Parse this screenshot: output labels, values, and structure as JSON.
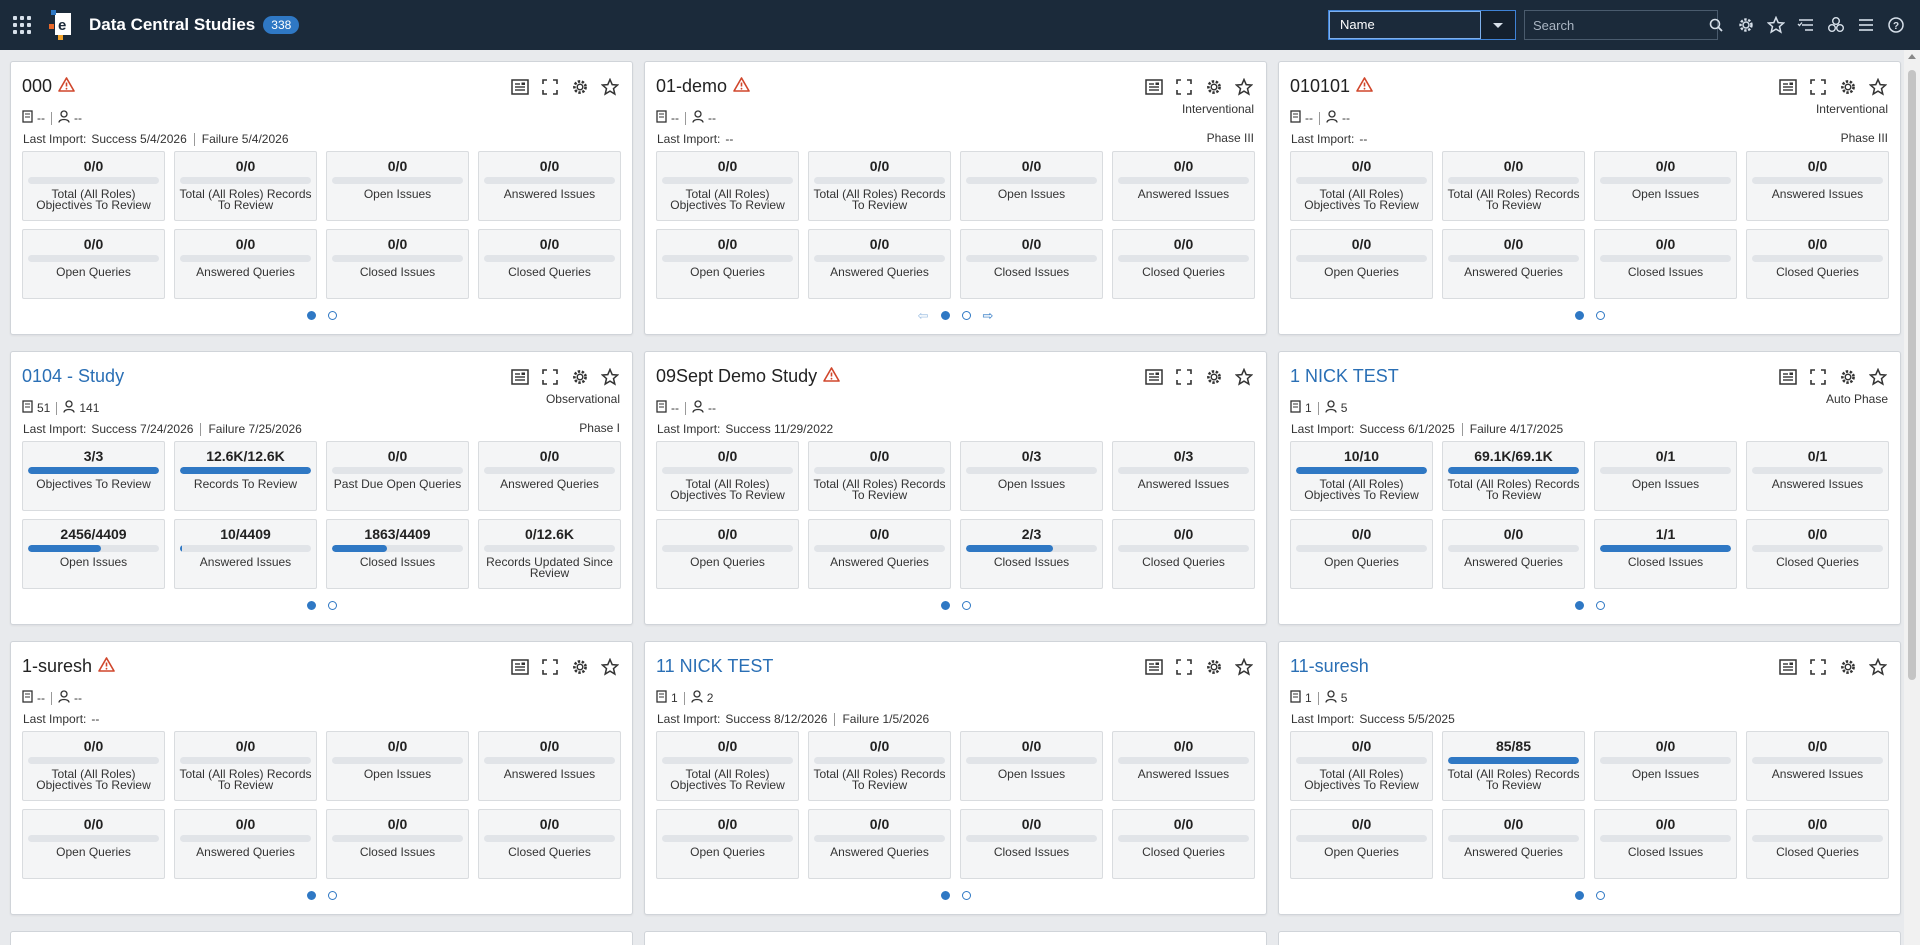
{
  "header": {
    "title": "Data Central Studies",
    "count": "338",
    "sort_value": "Name",
    "search_placeholder": "Search",
    "colors": {
      "bar": "#1b2a3a",
      "accent": "#2f78c4"
    }
  },
  "cards": [
    {
      "title": "000",
      "link": false,
      "warning": true,
      "type": "",
      "phase": "",
      "subjects": "--",
      "users": "--",
      "import_label": "Last Import:",
      "success": "Success  5/4/2026",
      "failure": "Failure  5/4/2026",
      "tiles": [
        {
          "value": "0/0",
          "label": "Total (All Roles) Objectives To Review",
          "fill": 0
        },
        {
          "value": "0/0",
          "label": "Total (All Roles) Records To Review",
          "fill": 0
        },
        {
          "value": "0/0",
          "label": "Open Issues",
          "fill": 0
        },
        {
          "value": "0/0",
          "label": "Answered Issues",
          "fill": 0
        },
        {
          "value": "0/0",
          "label": "Open Queries",
          "fill": 0
        },
        {
          "value": "0/0",
          "label": "Answered Queries",
          "fill": 0
        },
        {
          "value": "0/0",
          "label": "Closed Issues",
          "fill": 0
        },
        {
          "value": "0/0",
          "label": "Closed Queries",
          "fill": 0
        }
      ],
      "pages": 2,
      "arrows": false
    },
    {
      "title": "01-demo",
      "link": false,
      "warning": true,
      "type": "Interventional",
      "phase": "Phase III",
      "subjects": "--",
      "users": "--",
      "import_label": "Last Import:",
      "success": "--",
      "failure": "",
      "tiles": [
        {
          "value": "0/0",
          "label": "Total (All Roles) Objectives To Review",
          "fill": 0
        },
        {
          "value": "0/0",
          "label": "Total (All Roles) Records To Review",
          "fill": 0
        },
        {
          "value": "0/0",
          "label": "Open Issues",
          "fill": 0
        },
        {
          "value": "0/0",
          "label": "Answered Issues",
          "fill": 0
        },
        {
          "value": "0/0",
          "label": "Open Queries",
          "fill": 0
        },
        {
          "value": "0/0",
          "label": "Answered Queries",
          "fill": 0
        },
        {
          "value": "0/0",
          "label": "Closed Issues",
          "fill": 0
        },
        {
          "value": "0/0",
          "label": "Closed Queries",
          "fill": 0
        }
      ],
      "pages": 2,
      "arrows": true
    },
    {
      "title": "010101",
      "link": false,
      "warning": true,
      "type": "Interventional",
      "phase": "Phase III",
      "subjects": "--",
      "users": "--",
      "import_label": "Last Import:",
      "success": "--",
      "failure": "",
      "tiles": [
        {
          "value": "0/0",
          "label": "Total (All Roles) Objectives To Review",
          "fill": 0
        },
        {
          "value": "0/0",
          "label": "Total (All Roles) Records To Review",
          "fill": 0
        },
        {
          "value": "0/0",
          "label": "Open Issues",
          "fill": 0
        },
        {
          "value": "0/0",
          "label": "Answered Issues",
          "fill": 0
        },
        {
          "value": "0/0",
          "label": "Open Queries",
          "fill": 0
        },
        {
          "value": "0/0",
          "label": "Answered Queries",
          "fill": 0
        },
        {
          "value": "0/0",
          "label": "Closed Issues",
          "fill": 0
        },
        {
          "value": "0/0",
          "label": "Closed Queries",
          "fill": 0
        }
      ],
      "pages": 2,
      "arrows": false
    },
    {
      "title": "0104 - Study",
      "link": true,
      "warning": false,
      "type": "Observational",
      "phase": "Phase I",
      "subjects": "51",
      "users": "141",
      "import_label": "Last Import:",
      "success": "Success  7/24/2026",
      "failure": "Failure  7/25/2026",
      "tiles": [
        {
          "value": "3/3",
          "label": "Objectives To Review",
          "fill": 1
        },
        {
          "value": "12.6K/12.6K",
          "label": "Records To Review",
          "fill": 1
        },
        {
          "value": "0/0",
          "label": "Past Due Open Queries",
          "fill": 0
        },
        {
          "value": "0/0",
          "label": "Answered Queries",
          "fill": 0
        },
        {
          "value": "2456/4409",
          "label": "Open Issues",
          "fill": 0.557
        },
        {
          "value": "10/4409",
          "label": "Answered Issues",
          "fill": 0.0023
        },
        {
          "value": "1863/4409",
          "label": "Closed Issues",
          "fill": 0.4225
        },
        {
          "value": "0/12.6K",
          "label": "Records Updated Since Review",
          "fill": 0
        }
      ],
      "pages": 2,
      "arrows": false
    },
    {
      "title": "09Sept Demo Study",
      "link": false,
      "warning": true,
      "type": "",
      "phase": "",
      "subjects": "--",
      "users": "--",
      "import_label": "Last Import:",
      "success": "Success  11/29/2022",
      "failure": "",
      "tiles": [
        {
          "value": "0/0",
          "label": "Total (All Roles) Objectives To Review",
          "fill": 0
        },
        {
          "value": "0/0",
          "label": "Total (All Roles) Records To Review",
          "fill": 0
        },
        {
          "value": "0/3",
          "label": "Open Issues",
          "fill": 0
        },
        {
          "value": "0/3",
          "label": "Answered Issues",
          "fill": 0
        },
        {
          "value": "0/0",
          "label": "Open Queries",
          "fill": 0
        },
        {
          "value": "0/0",
          "label": "Answered Queries",
          "fill": 0
        },
        {
          "value": "2/3",
          "label": "Closed Issues",
          "fill": 0.667
        },
        {
          "value": "0/0",
          "label": "Closed Queries",
          "fill": 0
        }
      ],
      "pages": 2,
      "arrows": false
    },
    {
      "title": "1 NICK TEST",
      "link": true,
      "warning": false,
      "type": "Auto Phase",
      "phase": "",
      "subjects": "1",
      "users": "5",
      "import_label": "Last Import:",
      "success": "Success  6/1/2025",
      "failure": "Failure  4/17/2025",
      "tiles": [
        {
          "value": "10/10",
          "label": "Total (All Roles) Objectives To Review",
          "fill": 1
        },
        {
          "value": "69.1K/69.1K",
          "label": "Total (All Roles) Records To Review",
          "fill": 1
        },
        {
          "value": "0/1",
          "label": "Open Issues",
          "fill": 0
        },
        {
          "value": "0/1",
          "label": "Answered Issues",
          "fill": 0
        },
        {
          "value": "0/0",
          "label": "Open Queries",
          "fill": 0
        },
        {
          "value": "0/0",
          "label": "Answered Queries",
          "fill": 0
        },
        {
          "value": "1/1",
          "label": "Closed Issues",
          "fill": 1
        },
        {
          "value": "0/0",
          "label": "Closed Queries",
          "fill": 0
        }
      ],
      "pages": 2,
      "arrows": false
    },
    {
      "title": "1-suresh",
      "link": false,
      "warning": true,
      "type": "",
      "phase": "",
      "subjects": "--",
      "users": "--",
      "import_label": "Last Import:",
      "success": "--",
      "failure": "",
      "tiles": [
        {
          "value": "0/0",
          "label": "Total (All Roles) Objectives To Review",
          "fill": 0
        },
        {
          "value": "0/0",
          "label": "Total (All Roles) Records To Review",
          "fill": 0
        },
        {
          "value": "0/0",
          "label": "Open Issues",
          "fill": 0
        },
        {
          "value": "0/0",
          "label": "Answered Issues",
          "fill": 0
        },
        {
          "value": "0/0",
          "label": "Open Queries",
          "fill": 0
        },
        {
          "value": "0/0",
          "label": "Answered Queries",
          "fill": 0
        },
        {
          "value": "0/0",
          "label": "Closed Issues",
          "fill": 0
        },
        {
          "value": "0/0",
          "label": "Closed Queries",
          "fill": 0
        }
      ],
      "pages": 2,
      "arrows": false
    },
    {
      "title": "11 NICK TEST",
      "link": true,
      "warning": false,
      "type": "",
      "phase": "",
      "subjects": "1",
      "users": "2",
      "import_label": "Last Import:",
      "success": "Success  8/12/2026",
      "failure": "Failure  1/5/2026",
      "tiles": [
        {
          "value": "0/0",
          "label": "Total (All Roles) Objectives To Review",
          "fill": 0
        },
        {
          "value": "0/0",
          "label": "Total (All Roles) Records To Review",
          "fill": 0
        },
        {
          "value": "0/0",
          "label": "Open Issues",
          "fill": 0
        },
        {
          "value": "0/0",
          "label": "Answered Issues",
          "fill": 0
        },
        {
          "value": "0/0",
          "label": "Open Queries",
          "fill": 0
        },
        {
          "value": "0/0",
          "label": "Answered Queries",
          "fill": 0
        },
        {
          "value": "0/0",
          "label": "Closed Issues",
          "fill": 0
        },
        {
          "value": "0/0",
          "label": "Closed Queries",
          "fill": 0
        }
      ],
      "pages": 2,
      "arrows": false
    },
    {
      "title": "11-suresh",
      "link": true,
      "warning": false,
      "type": "",
      "phase": "",
      "subjects": "1",
      "users": "5",
      "import_label": "Last Import:",
      "success": "Success  5/5/2025",
      "failure": "",
      "tiles": [
        {
          "value": "0/0",
          "label": "Total (All Roles) Objectives To Review",
          "fill": 0
        },
        {
          "value": "85/85",
          "label": "Total (All Roles) Records To Review",
          "fill": 1
        },
        {
          "value": "0/0",
          "label": "Open Issues",
          "fill": 0
        },
        {
          "value": "0/0",
          "label": "Answered Issues",
          "fill": 0
        },
        {
          "value": "0/0",
          "label": "Open Queries",
          "fill": 0
        },
        {
          "value": "0/0",
          "label": "Answered Queries",
          "fill": 0
        },
        {
          "value": "0/0",
          "label": "Closed Issues",
          "fill": 0
        },
        {
          "value": "0/0",
          "label": "Closed Queries",
          "fill": 0
        }
      ],
      "pages": 2,
      "arrows": false
    }
  ]
}
